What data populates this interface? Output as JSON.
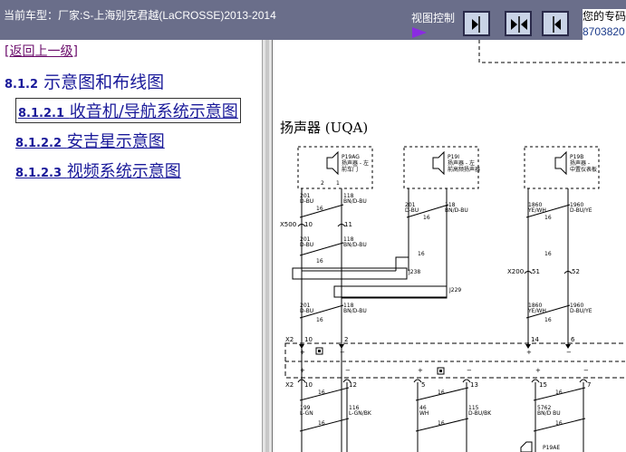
{
  "header": {
    "vehicle_text": "当前车型：厂家:S-上海别克君越(LaCROSSE)2013-2014",
    "view_control_label": "视图控制",
    "user_line1": "您的专码",
    "user_line2": "8703820"
  },
  "sidebar": {
    "back_link": "[返回上一级]",
    "section": {
      "num": "8.1.2",
      "label": "示意图和布线图"
    },
    "items": [
      {
        "num": "8.1.2.1",
        "label": "收音机/导航系统示意图",
        "selected": true
      },
      {
        "num": "8.1.2.2",
        "label": "安吉星示意图",
        "selected": false
      },
      {
        "num": "8.1.2.3",
        "label": "视频系统示意图",
        "selected": false
      }
    ]
  },
  "diagram": {
    "section_title": "扬声器 (UQA)",
    "speakers": [
      {
        "conn": "P19AG",
        "name_l1": "扬声器 - 左",
        "name_l2": "前车门"
      },
      {
        "conn": "P19I",
        "name_l1": "扬声器 - 左",
        "name_l2": "前高频扬声器"
      },
      {
        "conn": "P19B",
        "name_l1": "扬声器 -",
        "name_l2": "中置仪表板"
      }
    ],
    "wire_codes": {
      "w201": "201",
      "w118": "118",
      "w1860": "1860",
      "w1960": "1960",
      "w199": "199",
      "w116": "116",
      "w46": "46",
      "w115": "115",
      "w5762": "5762",
      "du": "D-BU",
      "bndbu": "BN/D-BU",
      "yewh": "YE/WH",
      "dbuye": "D-BU/YE",
      "lgn": "L-GN",
      "lgnbk": "L-GN/BK",
      "wh": "WH",
      "dbubk": "D-BU/BK",
      "bnbu": "BN/D BU",
      "gauge": "16"
    },
    "connectors": {
      "x500": "X500",
      "x200": "X200",
      "j238": "J238",
      "j229": "J229",
      "x2": "X2",
      "p10": "10",
      "p11": "11",
      "p51": "51",
      "p52": "52",
      "x2p10": "10",
      "x2p2": "2",
      "x2p14": "14",
      "x2p6": "6",
      "y12": "12",
      "y8": "8",
      "y5": "5",
      "y13": "13",
      "y15": "15",
      "y7": "7",
      "p19ae": "P19AE"
    }
  }
}
